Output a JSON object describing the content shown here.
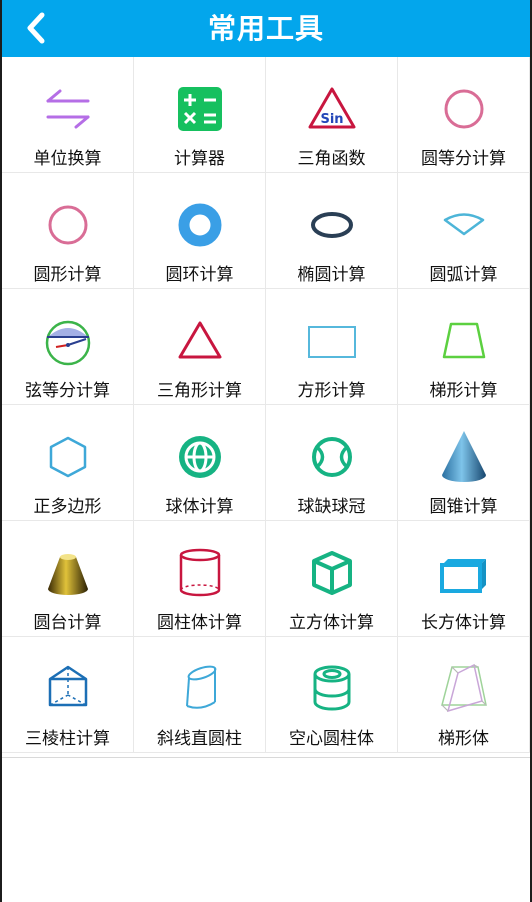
{
  "header": {
    "title": "常用工具"
  },
  "tools": [
    {
      "label": "单位换算",
      "icon": "swap-arrows-icon"
    },
    {
      "label": "计算器",
      "icon": "calculator-icon"
    },
    {
      "label": "三角函数",
      "icon": "triangle-sin-icon"
    },
    {
      "label": "圆等分计算",
      "icon": "circle-outline-icon"
    },
    {
      "label": "圆形计算",
      "icon": "circle-icon"
    },
    {
      "label": "圆环计算",
      "icon": "ring-icon"
    },
    {
      "label": "椭圆计算",
      "icon": "ellipse-icon"
    },
    {
      "label": "圆弧计算",
      "icon": "arc-sector-icon"
    },
    {
      "label": "弦等分计算",
      "icon": "chord-circle-icon"
    },
    {
      "label": "三角形计算",
      "icon": "triangle-icon"
    },
    {
      "label": "方形计算",
      "icon": "rectangle-icon"
    },
    {
      "label": "梯形计算",
      "icon": "trapezoid-icon"
    },
    {
      "label": "正多边形",
      "icon": "hexagon-icon"
    },
    {
      "label": "球体计算",
      "icon": "sphere-icon"
    },
    {
      "label": "球缺球冠",
      "icon": "spherical-cap-icon"
    },
    {
      "label": "圆锥计算",
      "icon": "cone-icon"
    },
    {
      "label": "圆台计算",
      "icon": "frustum-icon"
    },
    {
      "label": "圆柱体计算",
      "icon": "cylinder-icon"
    },
    {
      "label": "立方体计算",
      "icon": "cube-icon"
    },
    {
      "label": "长方体计算",
      "icon": "cuboid-icon"
    },
    {
      "label": "三棱柱计算",
      "icon": "triangular-prism-icon"
    },
    {
      "label": "斜线直圆柱",
      "icon": "slanted-cylinder-icon"
    },
    {
      "label": "空心圆柱体",
      "icon": "hollow-cylinder-icon"
    },
    {
      "label": "梯形体",
      "icon": "trapezoid-solid-icon"
    }
  ]
}
